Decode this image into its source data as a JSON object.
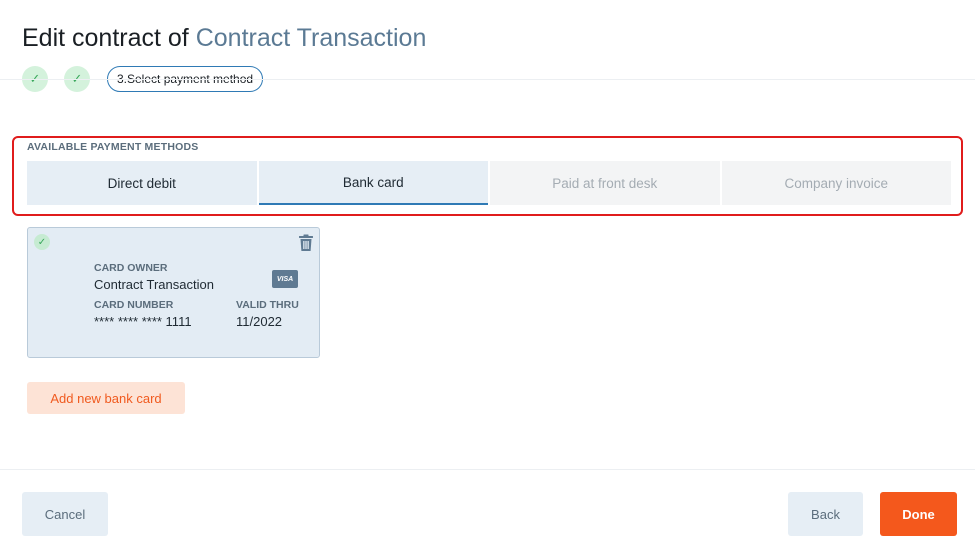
{
  "header": {
    "title_prefix": "Edit contract of",
    "title_accent": "Contract Transaction"
  },
  "steps": {
    "completed_icon": "check-icon",
    "current_label": "3.Select payment method"
  },
  "payment_methods": {
    "section_label": "AVAILABLE PAYMENT METHODS",
    "tabs": [
      {
        "label": "Direct debit",
        "state": "enabled"
      },
      {
        "label": "Bank card",
        "state": "active"
      },
      {
        "label": "Paid at front desk",
        "state": "disabled"
      },
      {
        "label": "Company invoice",
        "state": "disabled"
      }
    ]
  },
  "card": {
    "owner_label": "CARD OWNER",
    "owner_value": "Contract Transaction",
    "brand": "VISA",
    "number_label": "CARD NUMBER",
    "number_value": "**** **** **** 1111",
    "valid_label": "VALID THRU",
    "valid_value": "11/2022"
  },
  "actions": {
    "add_card_label": "Add new bank card",
    "cancel_label": "Cancel",
    "back_label": "Back",
    "done_label": "Done"
  },
  "colors": {
    "accent_blue": "#2f7ab5",
    "primary_orange": "#f4581c",
    "highlight_red": "#e01c1c",
    "success_green": "#3aa85c"
  }
}
